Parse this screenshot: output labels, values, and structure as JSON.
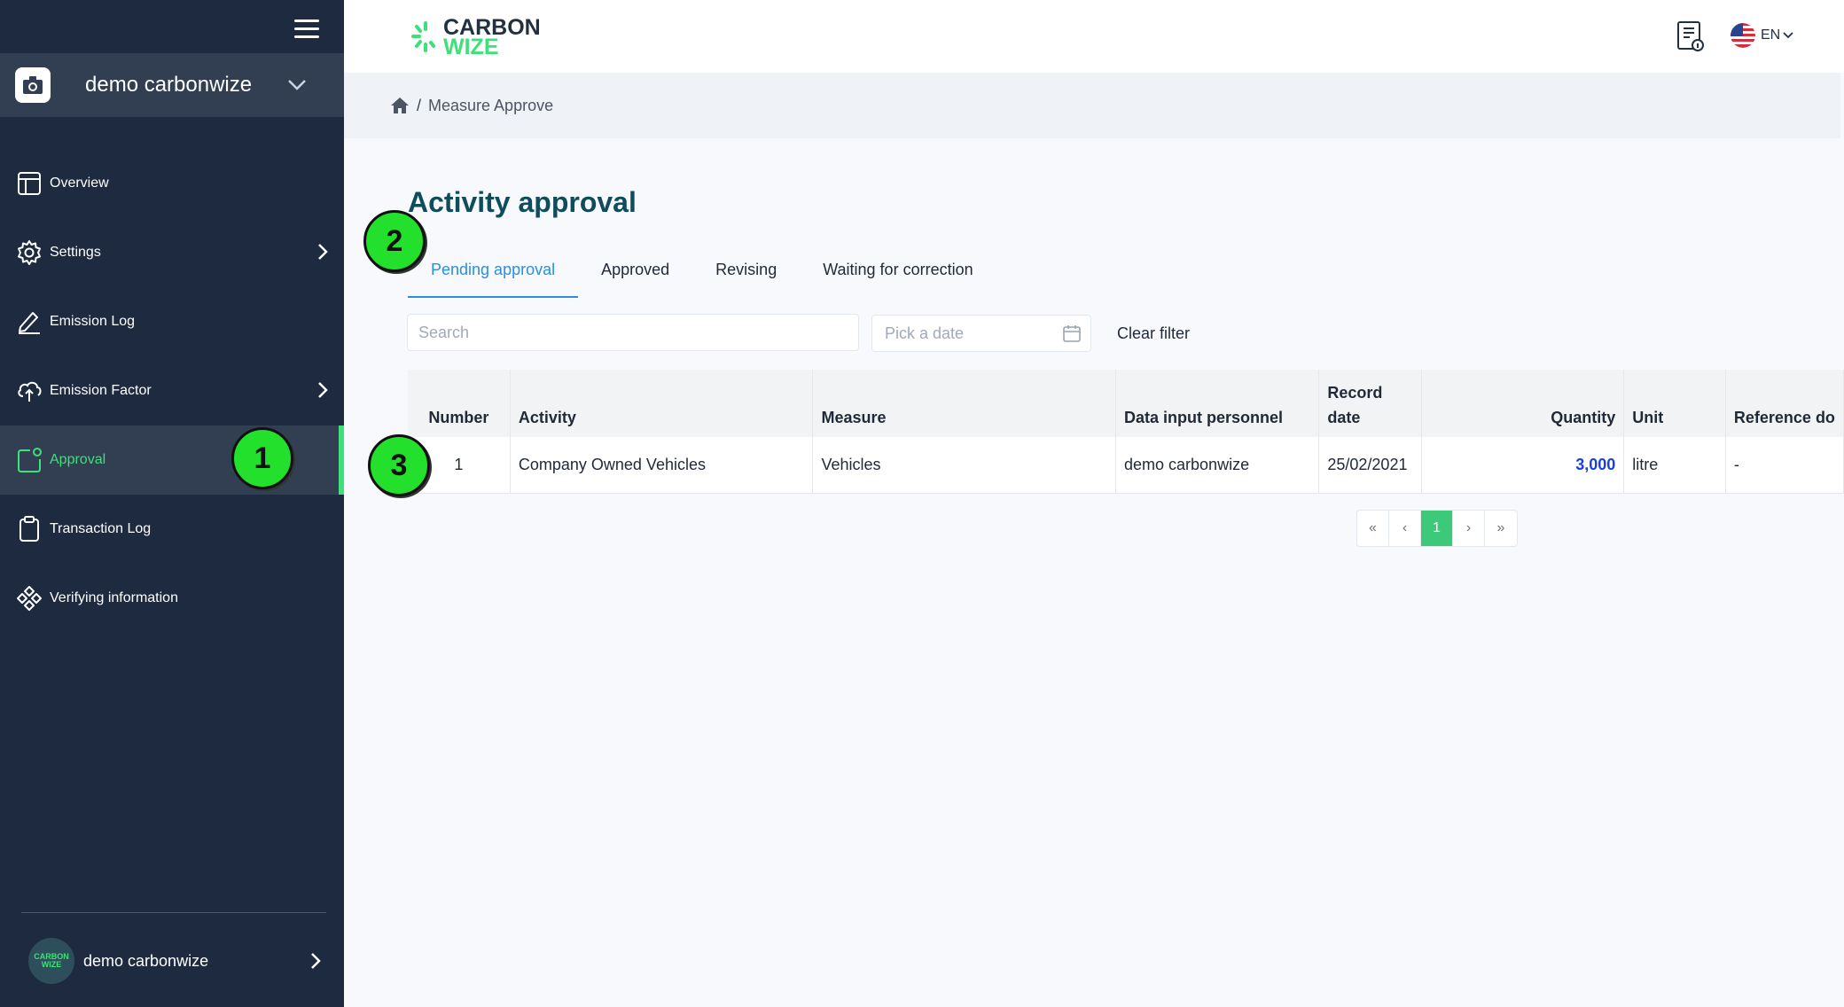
{
  "app": {
    "logo_top": "CARBON",
    "logo_bottom": "WIZE",
    "language": "EN"
  },
  "sidebar": {
    "org_name": "demo carbonwize",
    "items": [
      {
        "label": "Overview"
      },
      {
        "label": "Settings"
      },
      {
        "label": "Emission Log"
      },
      {
        "label": "Emission Factor"
      },
      {
        "label": "Approval"
      },
      {
        "label": "Transaction Log"
      },
      {
        "label": "Verifying information"
      }
    ],
    "user_name": "demo carbonwize",
    "user_avatar_top": "CARBON",
    "user_avatar_bottom": "WIZE"
  },
  "breadcrumb": {
    "separator": "/",
    "page": "Measure Approve"
  },
  "main": {
    "title": "Activity approval",
    "tabs": [
      {
        "label": "Pending approval",
        "active": true
      },
      {
        "label": "Approved"
      },
      {
        "label": "Revising"
      },
      {
        "label": "Waiting for correction"
      }
    ],
    "search_placeholder": "Search",
    "date_placeholder": "Pick a date",
    "clear_filter": "Clear filter"
  },
  "table": {
    "headers": [
      "Number",
      "Activity",
      "Measure",
      "Data input personnel",
      "Record date",
      "Quantity",
      "Unit",
      "Reference do"
    ],
    "rows": [
      [
        "1",
        "Company Owned Vehicles",
        "Vehicles",
        "demo carbonwize",
        "25/02/2021",
        "3,000",
        "litre",
        "-"
      ]
    ]
  },
  "pagination": {
    "first": "«",
    "prev": "‹",
    "current": "1",
    "next": "›",
    "last": "»"
  },
  "markers": [
    "1",
    "2",
    "3"
  ],
  "colors": {
    "sidebar_bg": "#1d2a3f",
    "accent_green": "#3ee07a",
    "tab_blue": "#2a8fe0",
    "title_teal": "#0f4c5c",
    "quantity_blue": "#1a3fe0"
  }
}
